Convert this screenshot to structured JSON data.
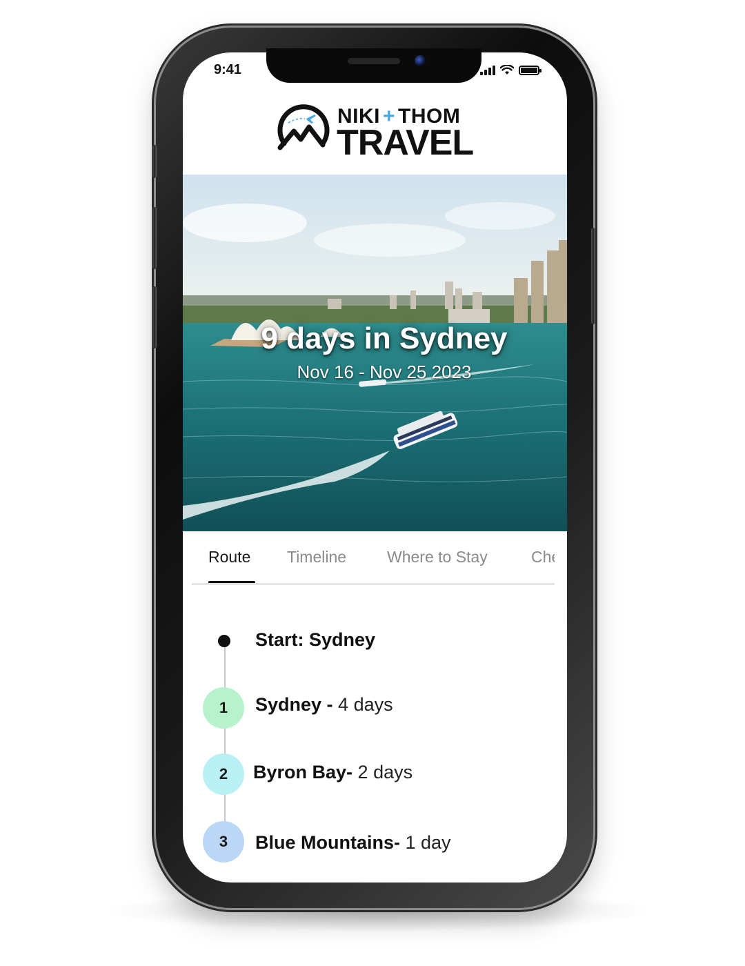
{
  "status_bar": {
    "time": "9:41"
  },
  "brand": {
    "line1_a": "NIKI",
    "line1_plus": "+",
    "line1_b": "THOM",
    "line2": "TRAVEL",
    "accent_color": "#4aa9e0"
  },
  "hero": {
    "title": "9 days in Sydney",
    "dates": "Nov 16 - Nov 25 2023"
  },
  "tabs": [
    {
      "label": "Route",
      "active": true
    },
    {
      "label": "Timeline",
      "active": false
    },
    {
      "label": "Where to Stay",
      "active": false
    },
    {
      "label": "Che",
      "active": false
    }
  ],
  "route": {
    "start": "Start: Sydney",
    "stops": [
      {
        "number": "1",
        "place": "Sydney - ",
        "duration": "4 days",
        "color": "#b8f2cc"
      },
      {
        "number": "2",
        "place": "Byron Bay- ",
        "duration": "2 days",
        "color": "#b9f0f5"
      },
      {
        "number": "3",
        "place": "Blue Mountains- ",
        "duration": "1 day",
        "color": "#bcd7f5"
      }
    ]
  }
}
